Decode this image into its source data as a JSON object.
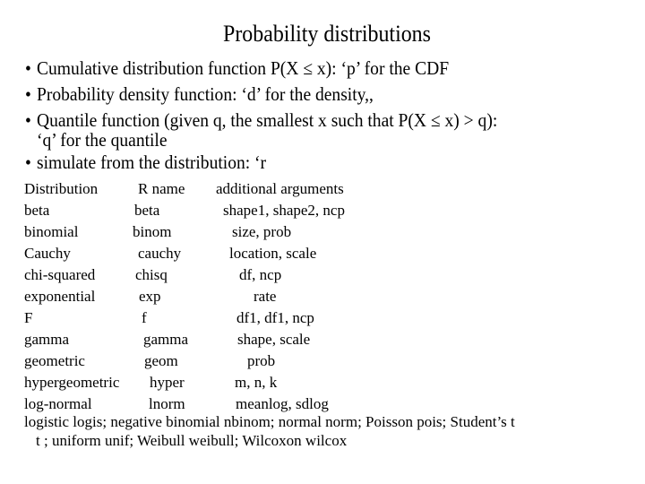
{
  "title": "Probability distributions",
  "bullets": [
    {
      "marker": "•",
      "text": "Cumulative distribution function P(X ≤ x): ‘p’ for the CDF"
    },
    {
      "marker": "•",
      "text": "Probability density function: ‘d’ for the density,,"
    },
    {
      "marker": "•",
      "text": "Quantile function (given q, the smallest x such that P(X ≤ x) > q):",
      "continuation": "‘q’ for the quantile"
    },
    {
      "marker": "•",
      "text": "simulate from the distribution: ‘r"
    }
  ],
  "table": {
    "headers": [
      "Distribution",
      "R name",
      "additional arguments"
    ],
    "rows": [
      [
        "beta",
        "beta",
        "shape1, shape2, ncp"
      ],
      [
        "binomial",
        "binom",
        "size, prob"
      ],
      [
        "Cauchy",
        "cauchy",
        "location, scale"
      ],
      [
        "chi-squared",
        "chisq",
        "df, ncp"
      ],
      [
        "exponential",
        "exp",
        "rate"
      ],
      [
        "F",
        "f",
        "df1, df1, ncp"
      ],
      [
        "gamma",
        "gamma",
        "shape, scale"
      ],
      [
        "geometric",
        "geom",
        "prob"
      ],
      [
        "hypergeometric",
        "hyper",
        "m, n, k"
      ],
      [
        "log-normal",
        "lnorm",
        "meanlog, sdlog"
      ]
    ]
  },
  "footer": {
    "line1": "logistic logis; negative binomial  nbinom; normal norm;  Poisson pois; Student’s t",
    "line2": "t ; uniform unif; Weibull weibull; Wilcoxon wilcox"
  }
}
